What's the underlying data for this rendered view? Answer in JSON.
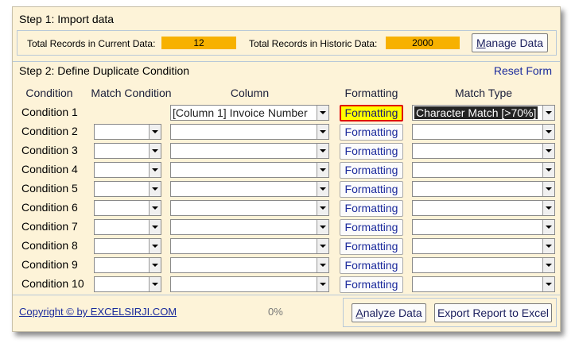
{
  "step1": {
    "title": "Step 1: Import data",
    "current_label": "Total Records in Current Data:",
    "current_value": "12",
    "historic_label": "Total Records in Historic Data:",
    "historic_value": "2000",
    "manage_btn_u": "M",
    "manage_btn_rest": "anage Data"
  },
  "step2": {
    "title": "Step 2: Define Duplicate Condition",
    "reset_label": "Reset Form",
    "headers": {
      "condition": "Condition",
      "match_condition": "Match Condition",
      "column": "Column",
      "formatting": "Formatting",
      "match_type": "Match Type"
    },
    "conditions": [
      {
        "label": "Condition 1",
        "match": null,
        "column": "[Column 1] Invoice Number",
        "formatting": "Formatting",
        "match_type": "Character Match [>70%]"
      },
      {
        "label": "Condition 2",
        "match": "",
        "column": "",
        "formatting": "Formatting",
        "match_type": ""
      },
      {
        "label": "Condition 3",
        "match": "",
        "column": "",
        "formatting": "Formatting",
        "match_type": ""
      },
      {
        "label": "Condition 4",
        "match": "",
        "column": "",
        "formatting": "Formatting",
        "match_type": ""
      },
      {
        "label": "Condition 5",
        "match": "",
        "column": "",
        "formatting": "Formatting",
        "match_type": ""
      },
      {
        "label": "Condition 6",
        "match": "",
        "column": "",
        "formatting": "Formatting",
        "match_type": ""
      },
      {
        "label": "Condition 7",
        "match": "",
        "column": "",
        "formatting": "Formatting",
        "match_type": ""
      },
      {
        "label": "Condition 8",
        "match": "",
        "column": "",
        "formatting": "Formatting",
        "match_type": ""
      },
      {
        "label": "Condition 9",
        "match": "",
        "column": "",
        "formatting": "Formatting",
        "match_type": ""
      },
      {
        "label": "Condition 10",
        "match": "",
        "column": "",
        "formatting": "Formatting",
        "match_type": ""
      }
    ]
  },
  "footer": {
    "copyright": "Copyright © by EXCELSIRJI.COM",
    "progress": "0%",
    "analyze_u": "A",
    "analyze_rest": "nalyze Data",
    "export_label": "Export Report to Excel"
  },
  "colors": {
    "panel_bg": "#fdf3d8",
    "count_box": "#f7b100",
    "link": "#1a2a9c",
    "active_fmt": "#ffff00",
    "active_border": "#e00000"
  }
}
